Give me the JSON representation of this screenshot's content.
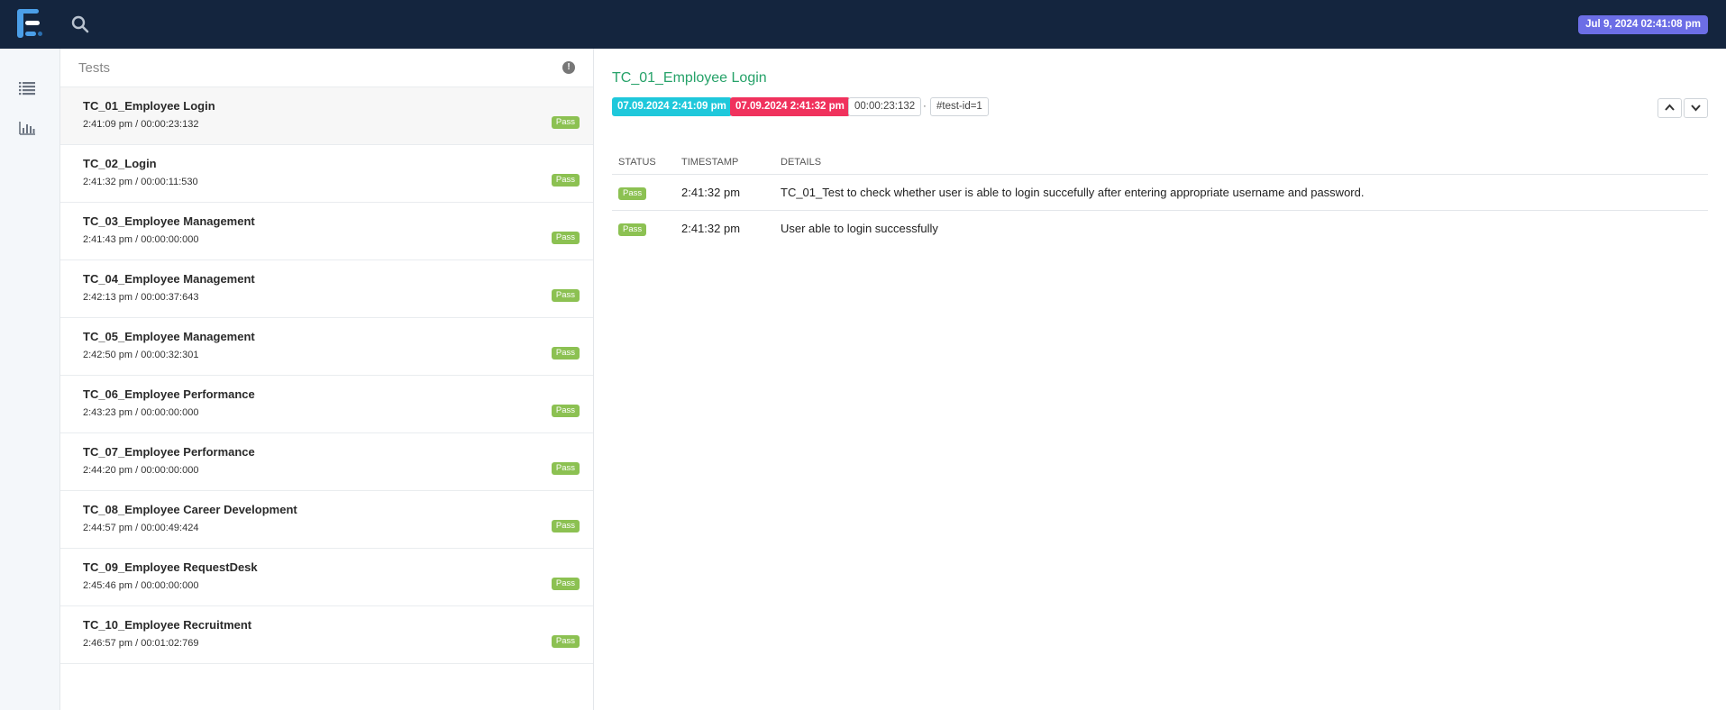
{
  "header": {
    "date": "Jul 9, 2024 02:41:08 pm"
  },
  "tests_panel": {
    "title": "Tests",
    "info_icon": "!"
  },
  "tests": [
    {
      "name": "TC_01_Employee Login",
      "time": "2:41:09 pm / 00:00:23:132",
      "status": "Pass"
    },
    {
      "name": "TC_02_Login",
      "time": "2:41:32 pm / 00:00:11:530",
      "status": "Pass"
    },
    {
      "name": "TC_03_Employee Management",
      "time": "2:41:43 pm / 00:00:00:000",
      "status": "Pass"
    },
    {
      "name": "TC_04_Employee Management",
      "time": "2:42:13 pm / 00:00:37:643",
      "status": "Pass"
    },
    {
      "name": "TC_05_Employee Management",
      "time": "2:42:50 pm / 00:00:32:301",
      "status": "Pass"
    },
    {
      "name": "TC_06_Employee Performance",
      "time": "2:43:23 pm / 00:00:00:000",
      "status": "Pass"
    },
    {
      "name": "TC_07_Employee Performance",
      "time": "2:44:20 pm / 00:00:00:000",
      "status": "Pass"
    },
    {
      "name": "TC_08_Employee Career Development",
      "time": "2:44:57 pm / 00:00:49:424",
      "status": "Pass"
    },
    {
      "name": "TC_09_Employee RequestDesk",
      "time": "2:45:46 pm / 00:00:00:000",
      "status": "Pass"
    },
    {
      "name": "TC_10_Employee Recruitment",
      "time": "2:46:57 pm / 00:01:02:769",
      "status": "Pass"
    }
  ],
  "detail": {
    "title": "TC_01_Employee Login",
    "start": "07.09.2024 2:41:09 pm",
    "end": "07.09.2024 2:41:32 pm",
    "duration": "00:00:23:132",
    "separator": "·",
    "test_id": "#test-id=1",
    "columns": {
      "status": "Status",
      "timestamp": "Timestamp",
      "details": "Details"
    },
    "logs": [
      {
        "status": "Pass",
        "timestamp": "2:41:32 pm",
        "details": "TC_01_Test to check whether user is able to login succefully after entering appropriate username and password."
      },
      {
        "status": "Pass",
        "timestamp": "2:41:32 pm",
        "details": "User able to login successfully"
      }
    ]
  },
  "icons": {
    "logo": "extent-logo",
    "search": "search-icon",
    "nav_list": "list-icon",
    "nav_dashboard": "bar-chart-icon",
    "info": "info-icon",
    "prev": "chevron-up-icon",
    "next": "chevron-down-icon"
  },
  "colors": {
    "topbar": "#14253e",
    "pass": "#8cc152",
    "start": "#1fc8db",
    "end": "#f0325d",
    "date_badge": "#6c6ee6",
    "title": "#26a269"
  }
}
